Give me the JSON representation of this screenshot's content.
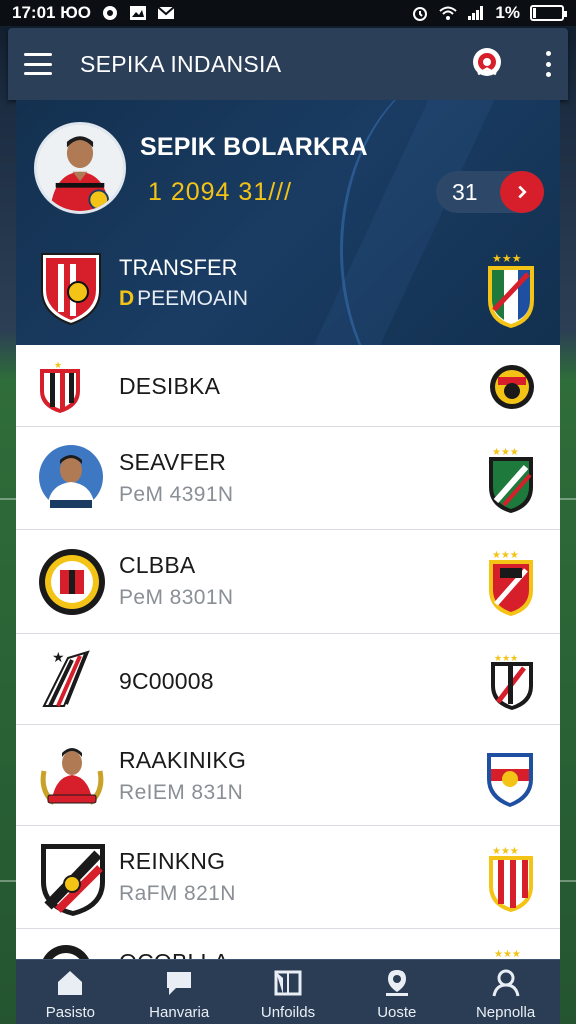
{
  "status_bar": {
    "time": "17:01 ЮО",
    "battery": "1%"
  },
  "app_bar": {
    "title": "SEPIKA INDANSIA",
    "menu_icon": "hamburger-menu-icon",
    "brand_icon": "brand-logo-icon",
    "more_icon": "more-vertical-icon"
  },
  "hero": {
    "player_name": "SEPIK BOLARKRA",
    "value": "1 2094 31///",
    "count": "31",
    "transfer_title": "TRANSFER",
    "transfer_sub_mark": "D",
    "transfer_sub": "PEEMOAIN",
    "accent_color": "#f3c316",
    "action_color": "#d61f2b"
  },
  "list": [
    {
      "title": "DESIBKA",
      "sub": ""
    },
    {
      "title": "SEAVFER",
      "sub": "PeM 4391N"
    },
    {
      "title": "CLBBA",
      "sub": "PeM 8301N"
    },
    {
      "title": "9C00008",
      "sub": ""
    },
    {
      "title": "RAAKINIKG",
      "sub": "ReIEM 831N"
    },
    {
      "title": "REINKNG",
      "sub": "RaFM 821N"
    },
    {
      "title": "OCOBLLA",
      "sub": ""
    }
  ],
  "bottom_nav": [
    {
      "label": "Pasisto",
      "icon": "home-icon"
    },
    {
      "label": "Hanvaria",
      "icon": "chat-icon"
    },
    {
      "label": "Unfoilds",
      "icon": "book-icon"
    },
    {
      "label": "Uoste",
      "icon": "location-pin-icon"
    },
    {
      "label": "Nepnolla",
      "icon": "profile-icon"
    }
  ]
}
